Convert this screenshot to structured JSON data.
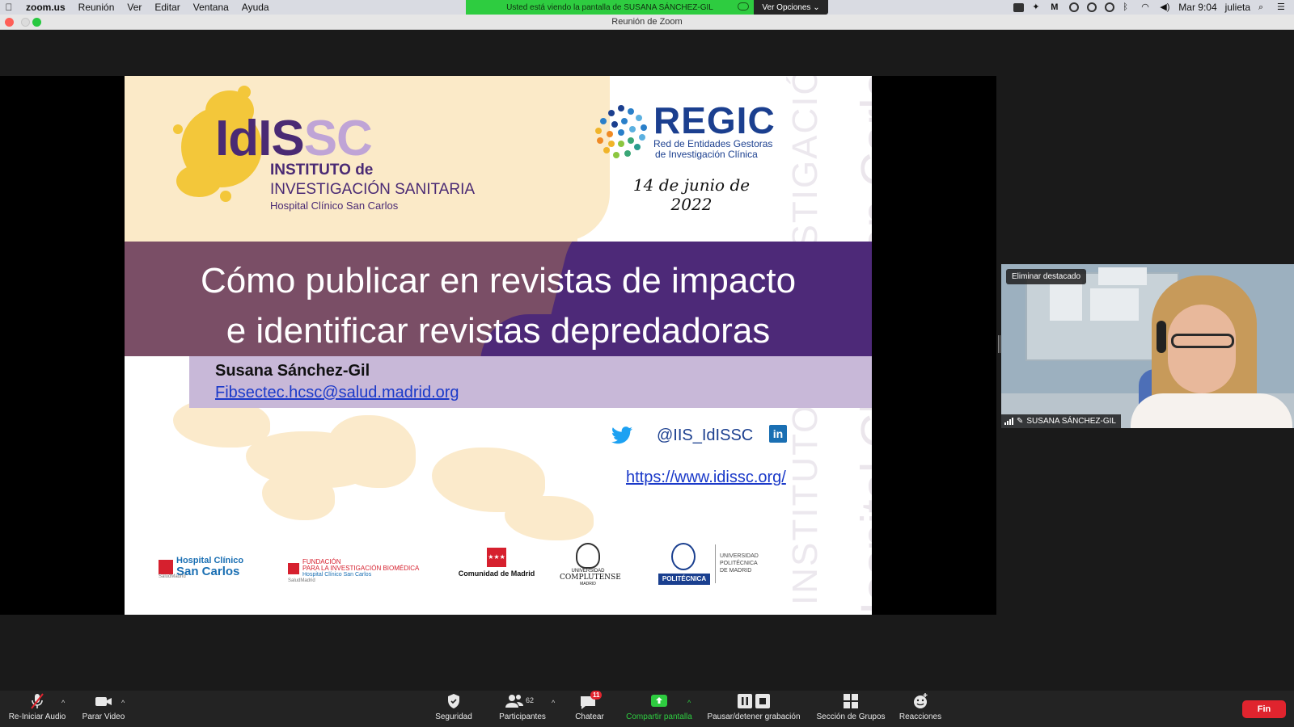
{
  "menubar": {
    "app_name": "zoom.us",
    "menus": [
      "Reunión",
      "Ver",
      "Editar",
      "Ventana",
      "Ayuda"
    ],
    "clock": "Mar 9:04",
    "user": "julieta"
  },
  "share_banner": {
    "text": "Usted está viendo la pantalla de SUSANA SÁNCHEZ-GIL",
    "view_options": "Ver Opciones ⌄"
  },
  "window": {
    "title": "Reunión de Zoom"
  },
  "slide": {
    "logo_main": "IdI",
    "logo_main_s": "S",
    "logo_main_sc": "SC",
    "logo_line1": "INSTITUTO de",
    "logo_line2": "INVESTIGACIÓN SANITARIA",
    "logo_line3": "Hospital Clínico San Carlos",
    "regic_title": "REGIC",
    "regic_sub1": "Red de Entidades Gestoras",
    "regic_sub2": "de Investigación Clínica",
    "date": "14 de junio de 2022",
    "title_line1": "Cómo publicar en revistas de impacto",
    "title_line2": "e identificar revistas depredadoras",
    "author": "Susana Sánchez-Gil",
    "email": "Fibsectec.hcsc@salud.madrid.org",
    "handle": "@IIS_IdISSC",
    "linkedin": "in",
    "website": "https://www.idissc.org/",
    "watermark1": "INSTITUTO de INVESTIGACIÓN SANITARIA",
    "watermark2": "Hospital Clínico San Carlos",
    "logos": {
      "hcsc_line1": "Hospital Clínico",
      "hcsc_line2": "San Carlos",
      "hcsc_small": "SaludMadrid",
      "fund_line1": "FUNDACIÓN",
      "fund_line2": "PARA LA INVESTIGACIÓN BIOMÉDICA",
      "fund_line3": "Hospital Clínico San Carlos",
      "fund_small": "SaludMadrid",
      "cam": "Comunidad de Madrid",
      "ucm_line1": "UNIVERSIDAD",
      "ucm_line2": "COMPLUTENSE",
      "ucm_line3": "MADRID",
      "upm_badge": "POLITÉCNICA",
      "upm_line1": "UNIVERSIDAD",
      "upm_line2": "POLITÉCNICA",
      "upm_line3": "DE MADRID"
    }
  },
  "video": {
    "pin_label": "Eliminar destacado",
    "participant_name": "SUSANA SÁNCHEZ-GIL"
  },
  "toolbar": {
    "audio": "Re-Iniciar Audio",
    "video": "Parar Video",
    "security": "Seguridad",
    "participants": "Participantes",
    "participants_count": "62",
    "chat": "Chatear",
    "chat_badge": "11",
    "share": "Compartir pantalla",
    "record": "Pausar/detener grabación",
    "breakout": "Sección de Grupos",
    "reactions": "Reacciones",
    "end": "Fin"
  },
  "colors": {
    "share_green": "#2ecc40",
    "slide_purple": "#4d2978",
    "slide_mauve": "#7a4e66",
    "end_red": "#e0242e"
  }
}
